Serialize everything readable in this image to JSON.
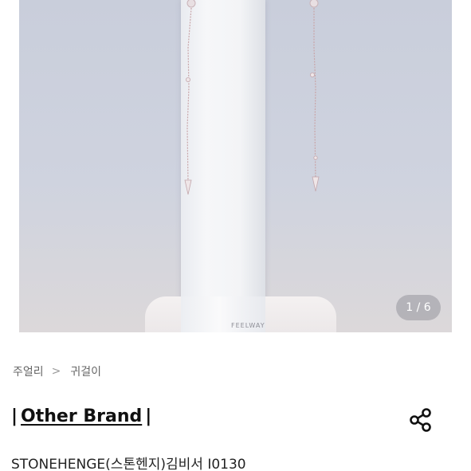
{
  "gallery": {
    "image_alt": "earrings-on-stand",
    "watermark": "FEELWAY",
    "pager": "1 / 6"
  },
  "breadcrumb": {
    "items": [
      "주얼리",
      "귀걸이"
    ],
    "separator": ">"
  },
  "brand": {
    "bar_left": "|",
    "name": "Other Brand",
    "bar_right": "|"
  },
  "share": {
    "icon": "share-icon"
  },
  "product": {
    "title": "STONEHENGE(스톤헨지)김비서 I0130"
  }
}
